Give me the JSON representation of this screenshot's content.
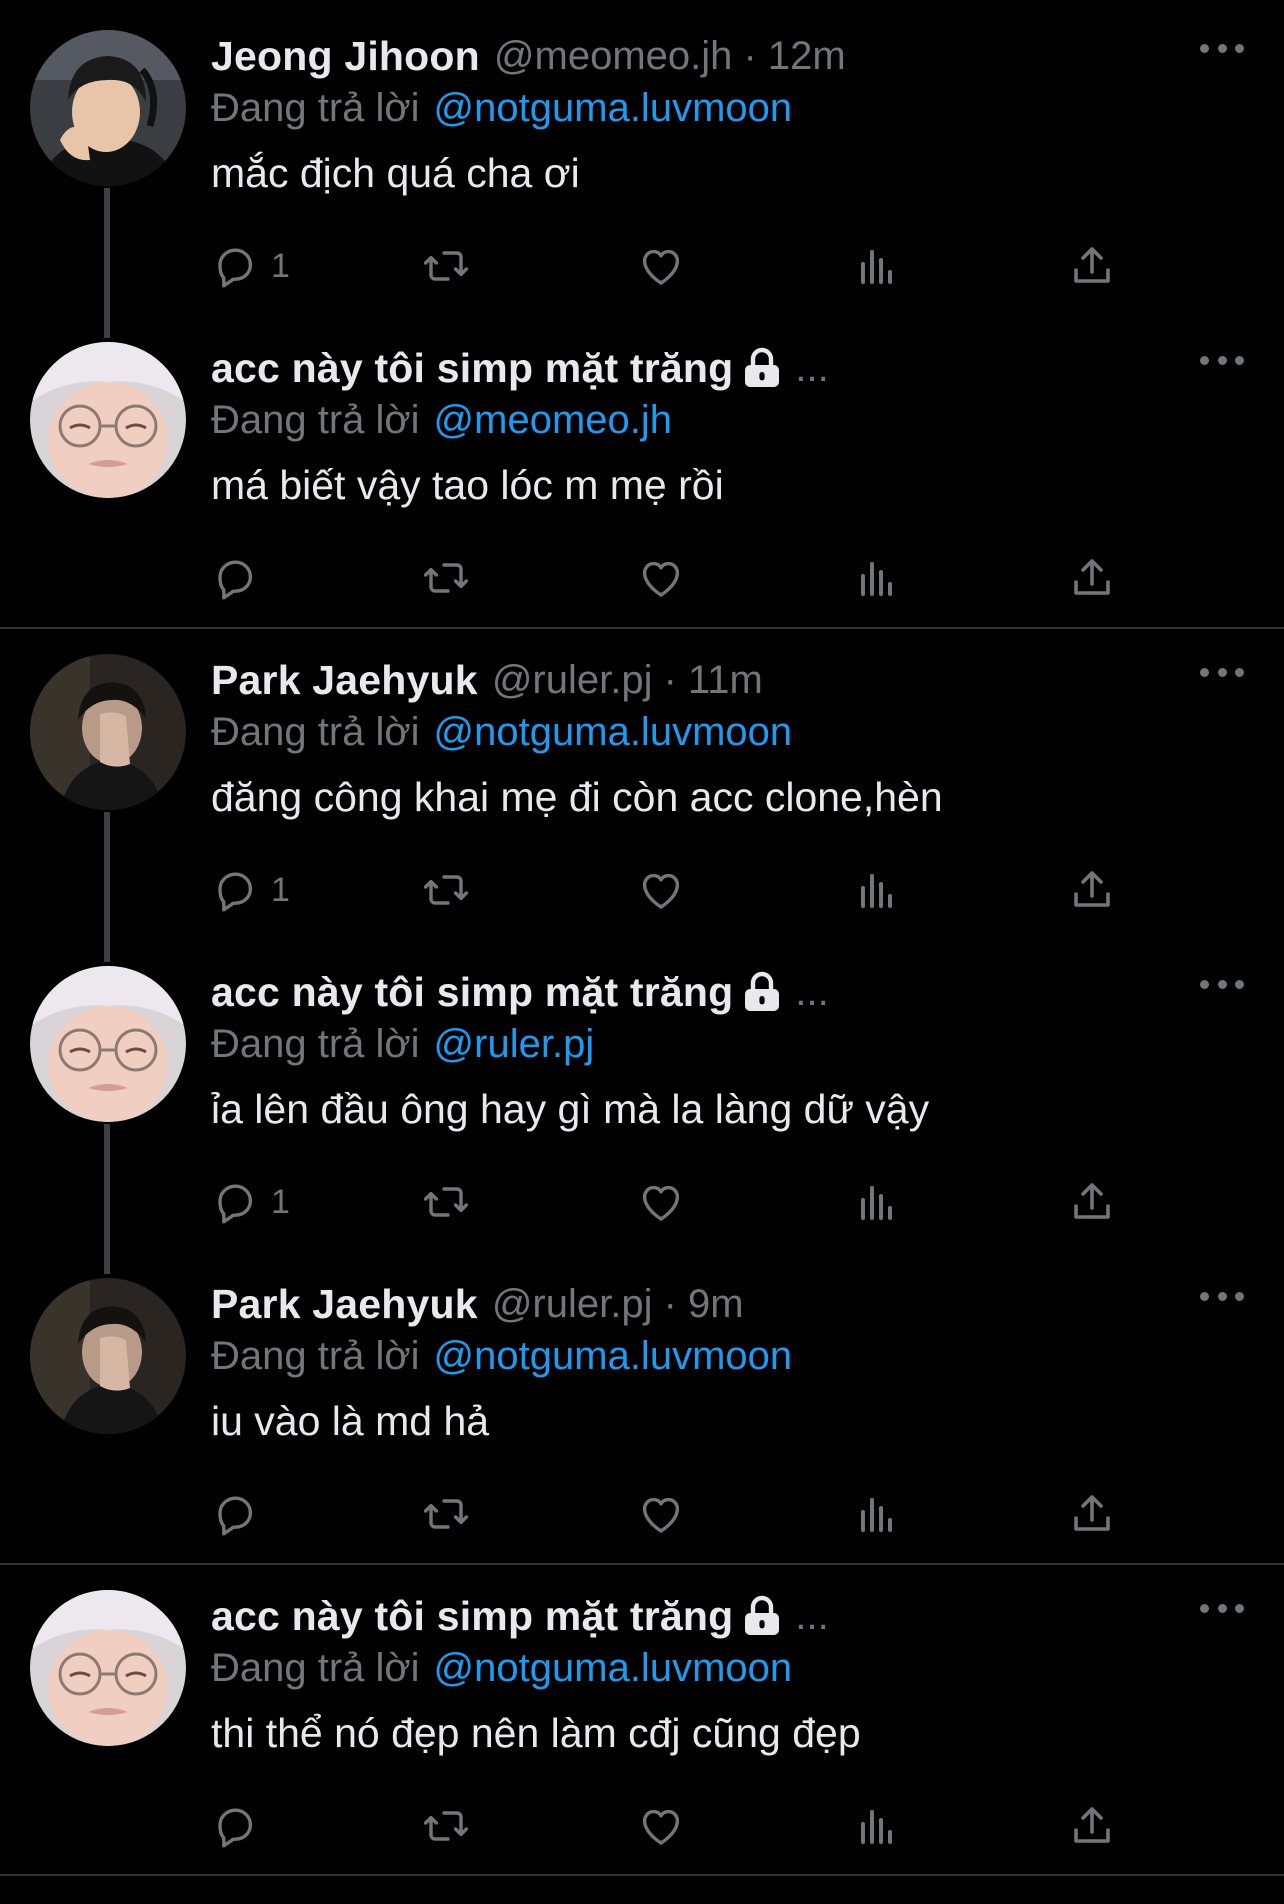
{
  "replying_prefix": "Đang trả lời",
  "tweets": [
    {
      "name": "Jeong Jihoon",
      "handle": "@meomeo.jh · 12m",
      "reply_to": "@notguma.luvmoon",
      "text": "mắc địch quá cha ơi",
      "reply_count": "1",
      "avatar": "person-dark-hair-headset",
      "locked": false
    },
    {
      "name": "acc này tôi simp mặt trăng",
      "handle": "...",
      "reply_to": "@meomeo.jh",
      "text": "má biết vậy tao lóc m mẹ rồi",
      "reply_count": "",
      "avatar": "person-white-hair-glasses",
      "locked": true
    },
    {
      "name": "Park Jaehyuk",
      "handle": "@ruler.pj · 11m",
      "reply_to": "@notguma.luvmoon",
      "text": "đăng công khai mẹ đi còn acc clone,hèn",
      "reply_count": "1",
      "avatar": "person-hand-on-face",
      "locked": false
    },
    {
      "name": "acc này tôi simp mặt trăng",
      "handle": "...",
      "reply_to": "@ruler.pj",
      "text": "ỉa lên đầu ông hay gì mà la làng dữ vậy",
      "reply_count": "1",
      "avatar": "person-white-hair-glasses",
      "locked": true
    },
    {
      "name": "Park Jaehyuk",
      "handle": "@ruler.pj · 9m",
      "reply_to": "@notguma.luvmoon",
      "text": "iu vào là md hả",
      "reply_count": "",
      "avatar": "person-hand-on-face",
      "locked": false
    },
    {
      "name": "acc này tôi simp mặt trăng",
      "handle": "...",
      "reply_to": "@notguma.luvmoon",
      "text": "thi thể nó đẹp nên làm cđj cũng đẹp",
      "reply_count": "",
      "avatar": "person-white-hair-glasses",
      "locked": true
    }
  ],
  "colors": {
    "background": "#000000",
    "text": "#e7e9ea",
    "secondary": "#71767b",
    "link": "#1d9bf0",
    "divider": "#2f3336"
  }
}
